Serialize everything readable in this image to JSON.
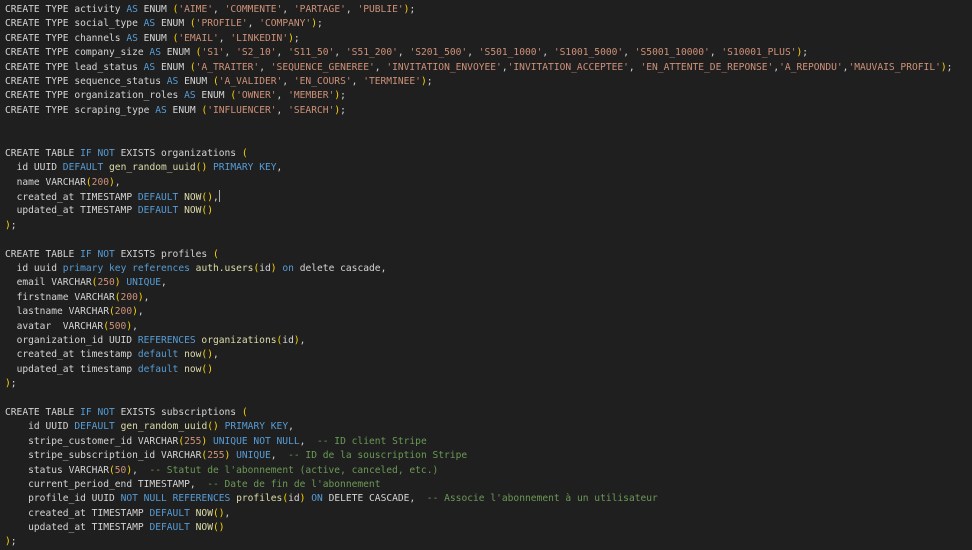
{
  "editor": {
    "lines": [
      "CREATE TYPE activity AS ENUM ('AIME', 'COMMENTE', 'PARTAGE', 'PUBLIE');",
      "CREATE TYPE social_type AS ENUM ('PROFILE', 'COMPANY');",
      "CREATE TYPE channels AS ENUM ('EMAIL', 'LINKEDIN');",
      "CREATE TYPE company_size AS ENUM ('S1', 'S2_10', 'S11_50', 'S51_200', 'S201_500', 'S501_1000', 'S1001_5000', 'S5001_10000', 'S10001_PLUS');",
      "CREATE TYPE lead_status AS ENUM ('A_TRAITER', 'SEQUENCE_GENEREE', 'INVITATION_ENVOYEE','INVITATION_ACCEPTEE', 'EN_ATTENTE_DE_REPONSE','A_REPONDU','MAUVAIS_PROFIL');",
      "CREATE TYPE sequence_status AS ENUM ('A_VALIDER', 'EN_COURS', 'TERMINEE');",
      "CREATE TYPE organization_roles AS ENUM ('OWNER', 'MEMBER');",
      "CREATE TYPE scraping_type AS ENUM ('INFLUENCER', 'SEARCH');",
      "",
      "",
      "CREATE TABLE IF NOT EXISTS organizations (",
      "  id UUID DEFAULT gen_random_uuid() PRIMARY KEY,",
      "  name VARCHAR(200),",
      "  created_at TIMESTAMP DEFAULT NOW(),",
      "  updated_at TIMESTAMP DEFAULT NOW()",
      ");",
      "",
      "CREATE TABLE IF NOT EXISTS profiles (",
      "  id uuid primary key references auth.users(id) on delete cascade,",
      "  email VARCHAR(250) UNIQUE,",
      "  firstname VARCHAR(200),",
      "  lastname VARCHAR(200),",
      "  avatar  VARCHAR(500),",
      "  organization_id UUID REFERENCES organizations(id),",
      "  created_at timestamp default now(),",
      "  updated_at timestamp default now()",
      ");",
      "",
      "CREATE TABLE IF NOT EXISTS subscriptions (",
      "    id UUID DEFAULT gen_random_uuid() PRIMARY KEY,",
      "    stripe_customer_id VARCHAR(255) UNIQUE NOT NULL,  -- ID client Stripe",
      "    stripe_subscription_id VARCHAR(255) UNIQUE,  -- ID de la souscription Stripe",
      "    status VARCHAR(50),  -- Statut de l'abonnement (active, canceled, etc.)",
      "    current_period_end TIMESTAMP,  -- Date de fin de l'abonnement",
      "    profile_id UUID NOT NULL REFERENCES profiles(id) ON DELETE CASCADE,  -- Associe l'abonnement à un utilisateur",
      "    created_at TIMESTAMP DEFAULT NOW(),",
      "    updated_at TIMESTAMP DEFAULT NOW()",
      ");"
    ],
    "cursor_line": 14
  }
}
